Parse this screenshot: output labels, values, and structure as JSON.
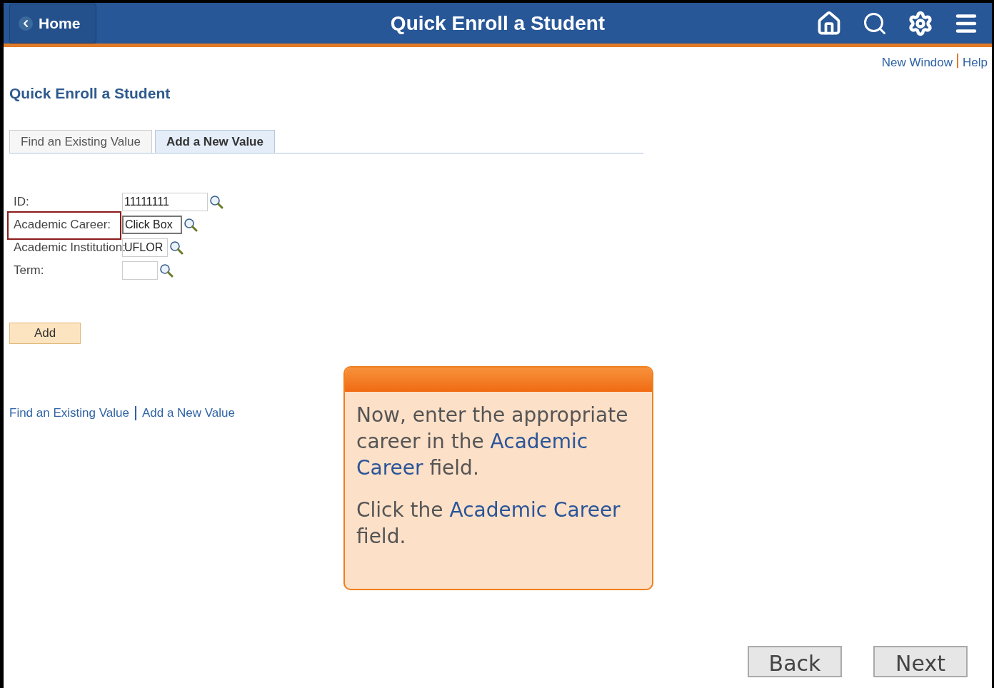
{
  "header": {
    "home_button": "Home",
    "title": "Quick Enroll a Student"
  },
  "top_links": [
    "New Window",
    "Help"
  ],
  "page_title": "Quick Enroll a Student",
  "tabs": [
    {
      "label": "Find an Existing Value",
      "selected": false
    },
    {
      "label": "Add a New Value",
      "selected": true
    }
  ],
  "fields": [
    {
      "label": "ID:",
      "value": "11111111",
      "highlighted": false
    },
    {
      "label": "Academic Career:",
      "highlighted": true,
      "overlay": "Click Box"
    },
    {
      "label": "Academic Institution:",
      "value": "UFLOR",
      "highlighted": false
    },
    {
      "label": "Term:",
      "highlighted": false
    }
  ],
  "add_button": "Add",
  "bottom_links": [
    "Find an Existing Value",
    "Add a New Value"
  ],
  "callout": {
    "paragraphs": [
      "Now, enter the appropriate career in the **Academic Career** field.",
      "Click the **Academic Career** field."
    ]
  },
  "nav_buttons": [
    "Back",
    "Next"
  ]
}
